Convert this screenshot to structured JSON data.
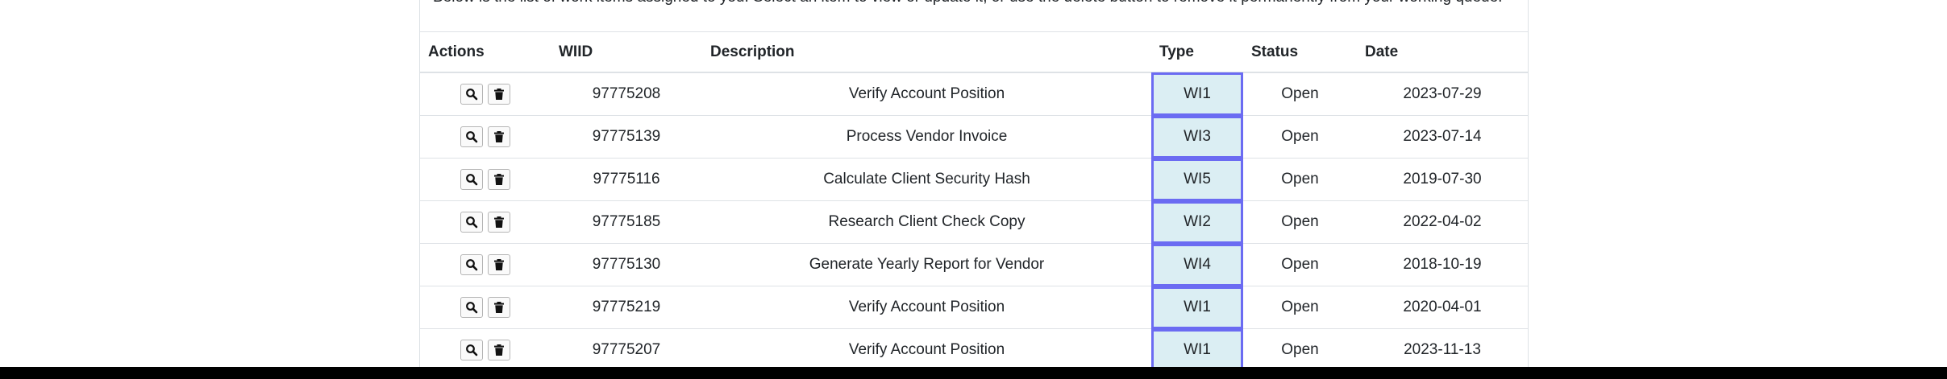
{
  "intro_text": "Below is the list of work items assigned to you. Select an item to view or update it, or use the delete button to remove it permanently from your working queue.",
  "table": {
    "headers": {
      "actions": "Actions",
      "wiid": "WIID",
      "description": "Description",
      "type": "Type",
      "status": "Status",
      "date": "Date"
    },
    "rows": [
      {
        "wiid": "97775208",
        "description": "Verify Account Position",
        "type": "WI1",
        "status": "Open",
        "date": "2023-07-29"
      },
      {
        "wiid": "97775139",
        "description": "Process Vendor Invoice",
        "type": "WI3",
        "status": "Open",
        "date": "2023-07-14"
      },
      {
        "wiid": "97775116",
        "description": "Calculate Client Security Hash",
        "type": "WI5",
        "status": "Open",
        "date": "2019-07-30"
      },
      {
        "wiid": "97775185",
        "description": "Research Client Check Copy",
        "type": "WI2",
        "status": "Open",
        "date": "2022-04-02"
      },
      {
        "wiid": "97775130",
        "description": "Generate Yearly Report for Vendor",
        "type": "WI4",
        "status": "Open",
        "date": "2018-10-19"
      },
      {
        "wiid": "97775219",
        "description": "Verify Account Position",
        "type": "WI1",
        "status": "Open",
        "date": "2020-04-01"
      },
      {
        "wiid": "97775207",
        "description": "Verify Account Position",
        "type": "WI1",
        "status": "Open",
        "date": "2023-11-13"
      }
    ]
  },
  "icons": {
    "view": "search-icon",
    "delete": "trash-icon"
  },
  "colors": {
    "type_cell_bg": "#dbeef3",
    "type_cell_border": "#6b6bf2",
    "row_divider": "#dee2e6"
  }
}
